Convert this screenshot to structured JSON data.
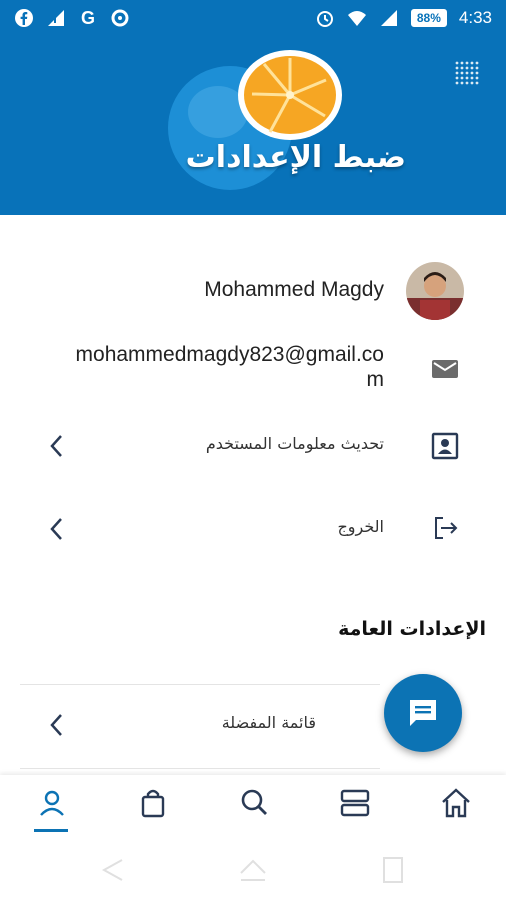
{
  "status_bar": {
    "left_icons": [
      "facebook-icon",
      "signal-alert-icon",
      "google-icon",
      "notification-app-icon"
    ],
    "battery": "88%",
    "time": "4:33"
  },
  "header": {
    "title": "ضبط الإعدادات"
  },
  "profile": {
    "name": "Mohammed Magdy",
    "email": "mohammedmagdy823@gmail.com"
  },
  "menu": {
    "update_user_info": "تحديث معلومات المستخدم",
    "logout": "الخروج"
  },
  "general_settings": {
    "title": "الإعدادات العامة",
    "favorites": "قائمة المفضلة"
  },
  "colors": {
    "primary": "#0872b9",
    "accent": "#0c73b4",
    "icon_gray": "#6b6b6b"
  },
  "bottom_nav": {
    "items": [
      "profile-icon",
      "bag-icon",
      "search-icon",
      "menu-layout-icon",
      "home-icon"
    ],
    "active": "profile-icon"
  }
}
